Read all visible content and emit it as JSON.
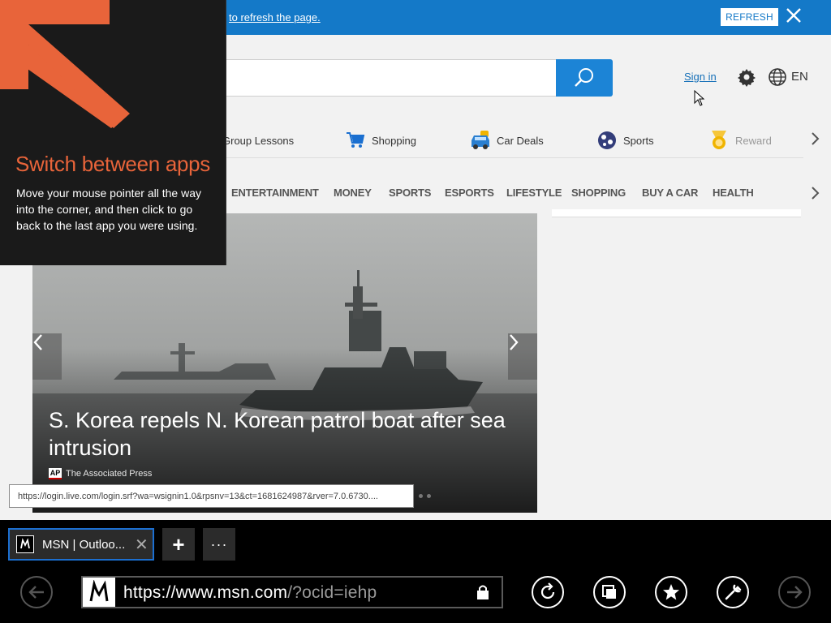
{
  "banner": {
    "text": "to refresh the page.",
    "refresh_label": "REFRESH",
    "close_icon": "close-icon"
  },
  "header": {
    "sign_in": "Sign in",
    "language": "EN",
    "icons": [
      "search-icon",
      "gear-icon",
      "globe-icon"
    ]
  },
  "quick_links": [
    {
      "label": "Group Lessons",
      "icon": "group-lessons-icon"
    },
    {
      "label": "Shopping",
      "icon": "shopping-cart-icon",
      "color": "#1a6fd0"
    },
    {
      "label": "Car Deals",
      "icon": "car-icon",
      "color": "#2a7fd0"
    },
    {
      "label": "Sports",
      "icon": "sports-icon",
      "color": "#333d7a"
    },
    {
      "label": "Reward",
      "icon": "reward-medal-icon",
      "color": "#f0b400"
    }
  ],
  "categories": [
    "ENTERTAINMENT",
    "MONEY",
    "SPORTS",
    "ESPORTS",
    "LIFESTYLE",
    "SHOPPING",
    "BUY A CAR",
    "HEALTH"
  ],
  "hero": {
    "headline": "S. Korea repels N. Korean patrol boat after sea intrusion",
    "source_logo": "AP",
    "source": "The Associated Press"
  },
  "status_url": "https://login.live.com/login.srf?wa=wsignin1.0&rpsnv=13&ct=1681624987&rver=7.0.6730....",
  "tip": {
    "title": "Switch between apps",
    "body": "Move your mouse pointer all the way into the corner, and then click to go back to the last app you were using.",
    "accent": "#e8643a"
  },
  "appbar": {
    "tab_title": "MSN | Outloo...",
    "tab_close": "✕",
    "new_tab": "+",
    "more": "···",
    "address_host": "https://www.msn.com",
    "address_path": "/?ocid=iehp",
    "icons": [
      "back-icon",
      "refresh-icon",
      "tabs-icon",
      "favorites-star-icon",
      "tools-wrench-icon",
      "forward-icon",
      "lock-icon"
    ],
    "active_tab_border": "#1c6fd0"
  }
}
